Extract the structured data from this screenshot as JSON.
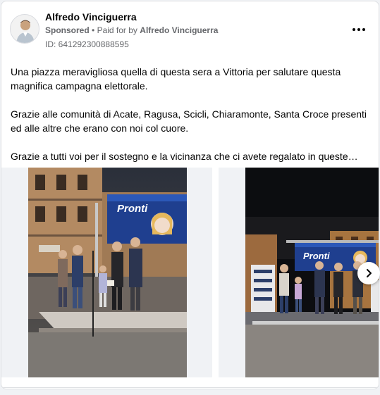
{
  "post": {
    "author_name": "Alfredo Vinciguerra",
    "sponsored_label": "Sponsored",
    "separator": "•",
    "paid_for_prefix": "Paid for by",
    "paid_for_name": "Alfredo Vinciguerra",
    "ad_id": "ID: 641292300888595",
    "paragraphs": [
      "Una piazza meravigliosa quella di questa sera a Vittoria per salutare questa magnifica campagna elettorale.",
      "Grazie alle comunità di Acate, Ragusa, Scicli, Chiaramonte, Santa Croce presenti ed alle altre che erano con noi col cuore.",
      "Grazie a tutti voi per il sostegno e la vicinanza che ci avete regalato in queste…"
    ]
  },
  "carousel": {
    "slides": [
      {
        "banner_text": "Pronti"
      },
      {
        "banner_text": "Pronti"
      }
    ]
  },
  "icons": {
    "more": "more-options-icon",
    "next": "chevron-right-icon"
  },
  "colors": {
    "text_primary": "#050505",
    "text_secondary": "#65676b",
    "banner_blue": "#1f3f8f",
    "card_bg": "#ffffff",
    "page_bg": "#f0f2f5"
  }
}
